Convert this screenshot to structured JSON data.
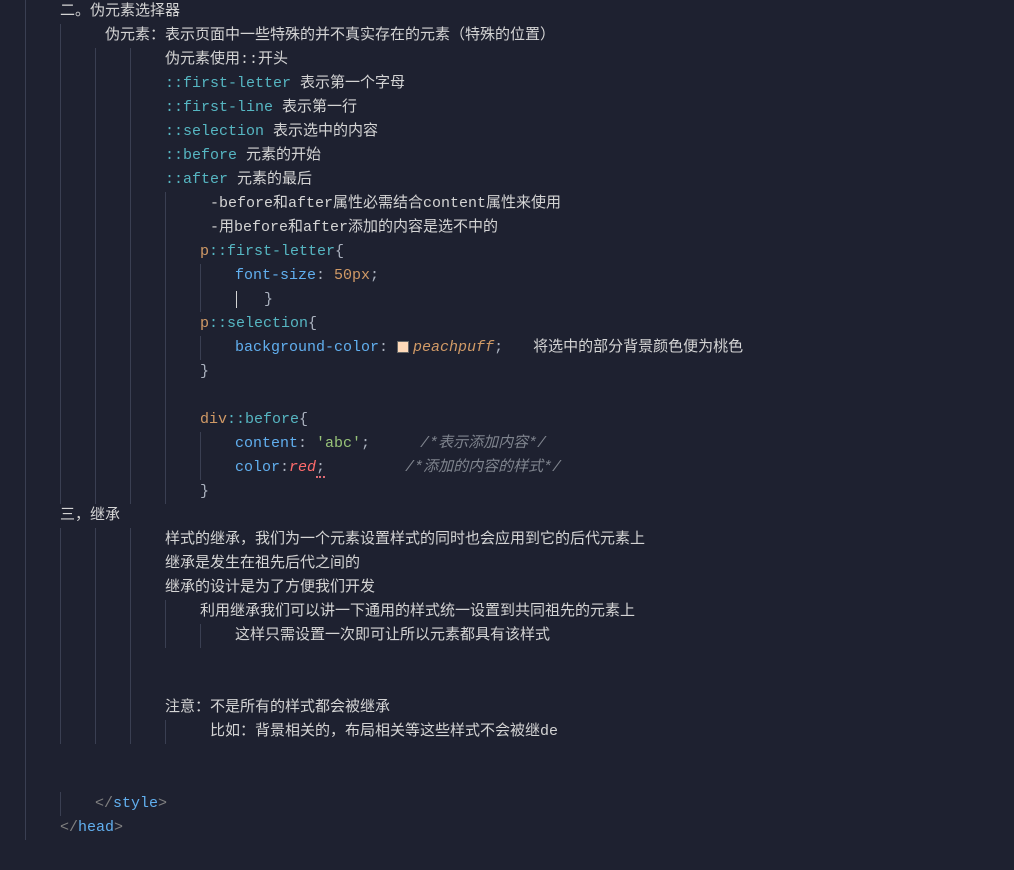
{
  "lines": {
    "l1": "二。伪元素选择器",
    "l2": "伪元素：表示页面中一些特殊的并不真实存在的元素（特殊的位置）",
    "l3": "伪元素使用::开头",
    "l4a": "::first-letter",
    "l4b": " 表示第一个字母",
    "l5a": "::first-line",
    "l5b": " 表示第一行",
    "l6a": "::selection",
    "l6b": " 表示选中的内容",
    "l7a": "::before",
    "l7b": "  元素的开始",
    "l8a": "::after",
    "l8b": "  元素的最后",
    "l9": "-before和after属性必需结合content属性来使用",
    "l10": "-用before和after添加的内容是选不中的",
    "l11a": "p",
    "l11b": "::first-letter",
    "l11c": "{",
    "l12a": "font-size",
    "l12b": ": ",
    "l12c": "50px",
    "l12d": ";",
    "l13b": "}",
    "l14a": "p",
    "l14b": "::selection",
    "l14c": "{",
    "l15a": "background-color",
    "l15b": ": ",
    "l15c": "peachpuff",
    "l15d": ";",
    "l15e": "将选中的部分背景颜色便为桃色",
    "l16": "}",
    "l18a": "div",
    "l18b": "::before",
    "l18c": "{",
    "l19a": "content",
    "l19b": ": ",
    "l19c": "'abc'",
    "l19d": ";",
    "l19e": "/*表示添加内容*/",
    "l20a": "color",
    "l20b": ":",
    "l20c": "red",
    "l20d": ";",
    "l20e": "/*添加的内容的样式*/",
    "l21": "}",
    "l22": "三，继承",
    "l23": "样式的继承，我们为一个元素设置样式的同时也会应用到它的后代元素上",
    "l24": "继承是发生在祖先后代之间的",
    "l25": "继承的设计是为了方便我们开发",
    "l26": "利用继承我们可以讲一下通用的样式统一设置到共同祖先的元素上",
    "l27": "这样只需设置一次即可让所以元素都具有该样式",
    "l30": "注意：不是所有的样式都会被继承",
    "l31": "比如：背景相关的，布局相关等这些样式不会被继de",
    "tag_style": "style",
    "tag_head": "head"
  }
}
